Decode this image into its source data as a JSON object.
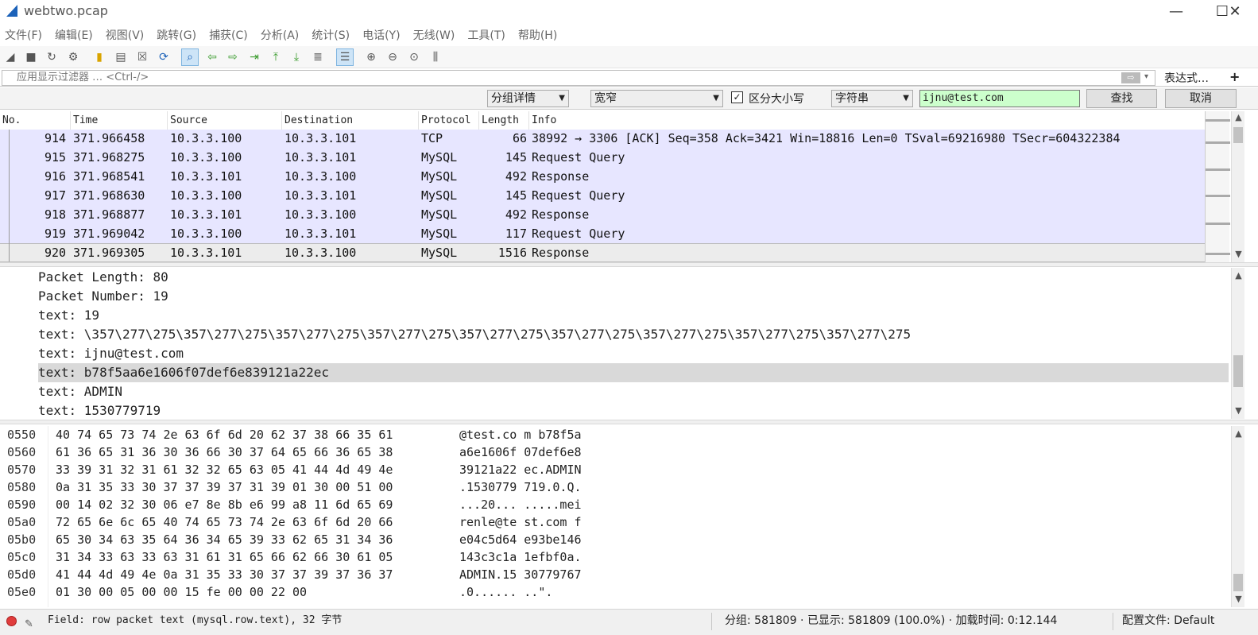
{
  "window": {
    "title": "webtwo.pcap",
    "controls": [
      "minimize-icon",
      "maximize-icon",
      "close-icon"
    ]
  },
  "menu": [
    "文件(F)",
    "编辑(E)",
    "视图(V)",
    "跳转(G)",
    "捕获(C)",
    "分析(A)",
    "统计(S)",
    "电话(Y)",
    "无线(W)",
    "工具(T)",
    "帮助(H)"
  ],
  "filter": {
    "placeholder": "应用显示过滤器 … <Ctrl-/>",
    "expression_label": "表达式…",
    "add_label": "+"
  },
  "find": {
    "scope": "分组详情",
    "charset": "宽窄",
    "case_sensitive_checked": true,
    "case_sensitive_label": "区分大小写",
    "type": "字符串",
    "value": "ijnu@test.com",
    "find_label": "查找",
    "cancel_label": "取消",
    "accent": "#ccffcc"
  },
  "packet_list": {
    "columns": [
      "No.",
      "Time",
      "Source",
      "Destination",
      "Protocol",
      "Length",
      "Info"
    ],
    "rows": [
      {
        "no": "914",
        "time": "371.966458",
        "src": "10.3.3.100",
        "dst": "10.3.3.101",
        "proto": "TCP",
        "len": "66",
        "info": "38992 → 3306 [ACK] Seq=358 Ack=3421 Win=18816 Len=0 TSval=69216980 TSecr=604322384"
      },
      {
        "no": "915",
        "time": "371.968275",
        "src": "10.3.3.100",
        "dst": "10.3.3.101",
        "proto": "MySQL",
        "len": "145",
        "info": "Request Query"
      },
      {
        "no": "916",
        "time": "371.968541",
        "src": "10.3.3.101",
        "dst": "10.3.3.100",
        "proto": "MySQL",
        "len": "492",
        "info": "Response"
      },
      {
        "no": "917",
        "time": "371.968630",
        "src": "10.3.3.100",
        "dst": "10.3.3.101",
        "proto": "MySQL",
        "len": "145",
        "info": "Request Query"
      },
      {
        "no": "918",
        "time": "371.968877",
        "src": "10.3.3.101",
        "dst": "10.3.3.100",
        "proto": "MySQL",
        "len": "492",
        "info": "Response"
      },
      {
        "no": "919",
        "time": "371.969042",
        "src": "10.3.3.100",
        "dst": "10.3.3.101",
        "proto": "MySQL",
        "len": "117",
        "info": "Request Query"
      },
      {
        "no": "920",
        "time": "371.969305",
        "src": "10.3.3.101",
        "dst": "10.3.3.100",
        "proto": "MySQL",
        "len": "1516",
        "info": "Response"
      }
    ],
    "selected_index": 6,
    "row_color": "#e7e6ff"
  },
  "details": {
    "lines": [
      "Packet Length: 80",
      "Packet Number: 19",
      "text: 19",
      "text: \\357\\277\\275\\357\\277\\275\\357\\277\\275\\357\\277\\275\\357\\277\\275\\357\\277\\275\\357\\277\\275\\357\\277\\275\\357\\277\\275",
      "text: ijnu@test.com",
      "text: b78f5aa6e1606f07def6e839121a22ec",
      "text: ADMIN",
      "text: 1530779719"
    ],
    "highlighted_index": 5
  },
  "bytes": {
    "lines": [
      {
        "offset": "0550",
        "hex": "40 74 65 73 74 2e 63 6f  6d 20 62 37 38 66 35 61",
        "ascii": "@test.co m b78f5a"
      },
      {
        "offset": "0560",
        "hex": "61 36 65 31 36 30 36 66  30 37 64 65 66 36 65 38",
        "ascii": "a6e1606f 07def6e8"
      },
      {
        "offset": "0570",
        "hex": "33 39 31 32 31 61 32 32  65 63 05 41 44 4d 49 4e",
        "ascii": "39121a22 ec.ADMIN"
      },
      {
        "offset": "0580",
        "hex": "0a 31 35 33 30 37 37 39  37 31 39 01 30 00 51 00",
        "ascii": ".1530779 719.0.Q."
      },
      {
        "offset": "0590",
        "hex": "00 14 02 32 30 06 e7 8e  8b e6 99 a8 11 6d 65 69",
        "ascii": "...20... .....mei"
      },
      {
        "offset": "05a0",
        "hex": "72 65 6e 6c 65 40 74 65  73 74 2e 63 6f 6d 20 66",
        "ascii": "renle@te st.com f"
      },
      {
        "offset": "05b0",
        "hex": "65 30 34 63 35 64 36 34  65 39 33 62 65 31 34 36",
        "ascii": "e04c5d64 e93be146"
      },
      {
        "offset": "05c0",
        "hex": "31 34 33 63 33 63 31 61  31 65 66 62 66 30 61 05",
        "ascii": "143c3c1a 1efbf0a."
      },
      {
        "offset": "05d0",
        "hex": "41 44 4d 49 4e 0a 31 35  33 30 37 37 39 37 36 37",
        "ascii": "ADMIN.15 30779767"
      },
      {
        "offset": "05e0",
        "hex": "01 30 00 05 00 00 15 fe  00 00 22 00",
        "ascii": ".0...... ..\"."
      }
    ]
  },
  "status": {
    "field": "Field: row packet text (mysql.row.text), 32 字节",
    "packets": "分组: 581809 · 已显示: 581809 (100.0%) · 加载时间: 0:12.144",
    "profile": "配置文件: Default"
  }
}
